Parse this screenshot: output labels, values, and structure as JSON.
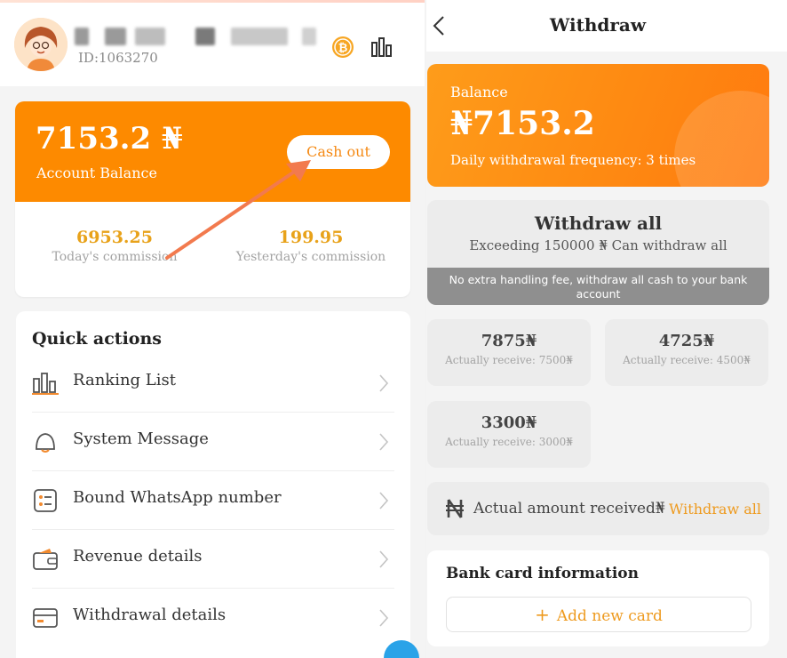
{
  "left": {
    "profile": {
      "user_id": "ID:1063270",
      "avatar_icon": "avatar-girl-glasses",
      "coin_icon": "bitcoin-coin-icon",
      "rank_icon": "bar-chart-icon"
    },
    "balance": {
      "amount": "7153.2 ₦",
      "label": "Account Balance",
      "cashout_label": "Cash out",
      "today_value": "6953.25",
      "today_label": "Today's commission",
      "yesterday_value": "199.95",
      "yesterday_label": "Yesterday's commission"
    },
    "quick_actions": {
      "title": "Quick actions",
      "items": [
        {
          "label": "Ranking List",
          "icon": "bar-chart-icon"
        },
        {
          "label": "System Message",
          "icon": "bell-icon"
        },
        {
          "label": "Bound WhatsApp number",
          "icon": "list-check-icon"
        },
        {
          "label": "Revenue details",
          "icon": "wallet-icon"
        },
        {
          "label": "Withdrawal details",
          "icon": "card-icon"
        }
      ]
    }
  },
  "right": {
    "title": "Withdraw",
    "balance": {
      "label": "Balance",
      "amount": "₦7153.2",
      "frequency": "Daily withdrawal frequency: 3 times"
    },
    "withdraw_all": {
      "title": "Withdraw all",
      "subtitle": "Exceeding 150000 ₦ Can withdraw all",
      "note": "No extra handling fee, withdraw all cash to your bank account"
    },
    "options": [
      {
        "amount": "7875₦",
        "receive": "Actually receive: 7500₦"
      },
      {
        "amount": "4725₦",
        "receive": "Actually receive: 4500₦"
      },
      {
        "amount": "3300₦",
        "receive": "Actually receive: 3000₦"
      }
    ],
    "received": {
      "label": "Actual amount received₦",
      "action": "Withdraw all"
    },
    "bank": {
      "title": "Bank card information",
      "add_label": "Add new card"
    }
  },
  "colors": {
    "accent": "#fd8a00",
    "gold_text": "#e8a21a",
    "link_orange": "#ee9a1e",
    "arrow": "#f27a4e"
  }
}
